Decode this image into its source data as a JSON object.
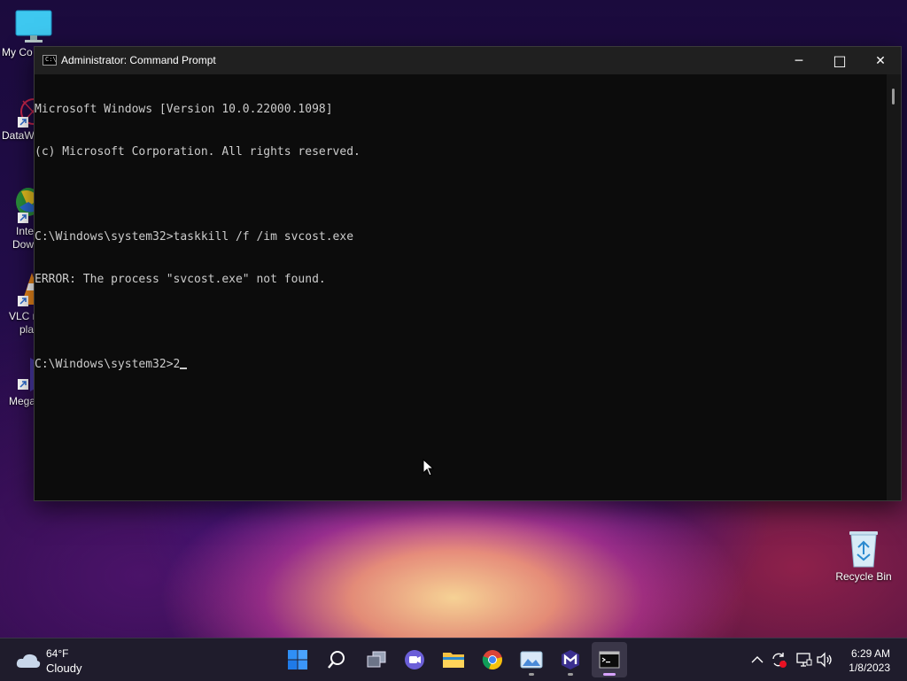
{
  "desktop": {
    "icons": [
      {
        "label": "My Co"
      },
      {
        "label": "DataW"
      },
      {
        "label_line1": "Inte",
        "label_line2": "Dow"
      },
      {
        "label_line1": "VLC r",
        "label_line2": "pla"
      },
      {
        "label": "Mega"
      },
      {
        "label": "Recycle Bin"
      }
    ]
  },
  "window": {
    "title": "Administrator: Command Prompt",
    "title_icon_text": "C:\\",
    "controls": {
      "minimize": "─",
      "maximize": "□",
      "close": "✕"
    },
    "console_lines": [
      "Microsoft Windows [Version 10.0.22000.1098]",
      "(c) Microsoft Corporation. All rights reserved.",
      "",
      "C:\\Windows\\system32>taskkill /f /im svcost.exe",
      "ERROR: The process \"svcost.exe\" not found.",
      "",
      "C:\\Windows\\system32>2"
    ]
  },
  "taskbar": {
    "weather": {
      "temp": "64°F",
      "condition": "Cloudy"
    },
    "apps": [
      "start-icon",
      "search-icon",
      "task-view-icon",
      "teams-chat-icon",
      "file-explorer-icon",
      "chrome-icon",
      "photos-icon",
      "malwarebytes-icon",
      "command-prompt-icon"
    ],
    "tray": [
      "chevron-up-icon",
      "sync-icon",
      "network-icon",
      "volume-icon"
    ],
    "clock": {
      "time": "6:29 AM",
      "date": "1/8/2023"
    }
  },
  "colors": {
    "console_bg": "#0c0c0c",
    "console_text": "#cccccc",
    "accent": "#d8a3ff"
  }
}
